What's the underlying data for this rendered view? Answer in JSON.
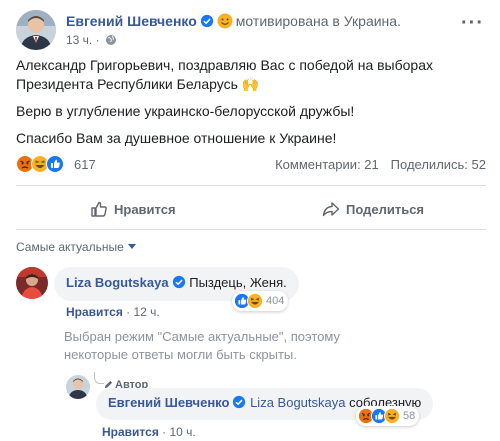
{
  "post": {
    "author": "Евгений Шевченко",
    "feeling": "мотивирована в Украина.",
    "time": "13 ч.",
    "more": "···",
    "paragraphs": [
      "Александр Григорьевич, поздравляю Вас с победой на выборах Президента Республики Беларусь 🙌",
      "Верю в углубление украинско-белорусской дружбы!",
      "Спасибо Вам за душевное отношение к Украине!"
    ],
    "reactions_count": "617",
    "comments": "Комментарии: 21",
    "shares": "Поделились: 52",
    "like_label": "Нравится",
    "share_label": "Поделиться"
  },
  "comments": {
    "sort_label": "Самые актуальные",
    "items": [
      {
        "author": "Liza Bogutskaya",
        "text": "Пыздець, Женя.",
        "like_label": "Нравится",
        "time": "12 ч.",
        "reaction_count": "404"
      }
    ],
    "notice": "Выбран режим \"Самые актуальные\", поэтому некоторые ответы могли быть скрыты.",
    "reply": {
      "tag": "Автор",
      "author": "Евгений Шевченко",
      "mention": "Liza Bogutskaya",
      "text": "соболезную",
      "like_label": "Нравится",
      "time": "10 ч.",
      "reaction_count": "58"
    }
  },
  "colors": {
    "link": "#385898",
    "like_blue": "#1877f2",
    "haha_yellow": "#f7b125",
    "angry_red": "#e9710f"
  }
}
